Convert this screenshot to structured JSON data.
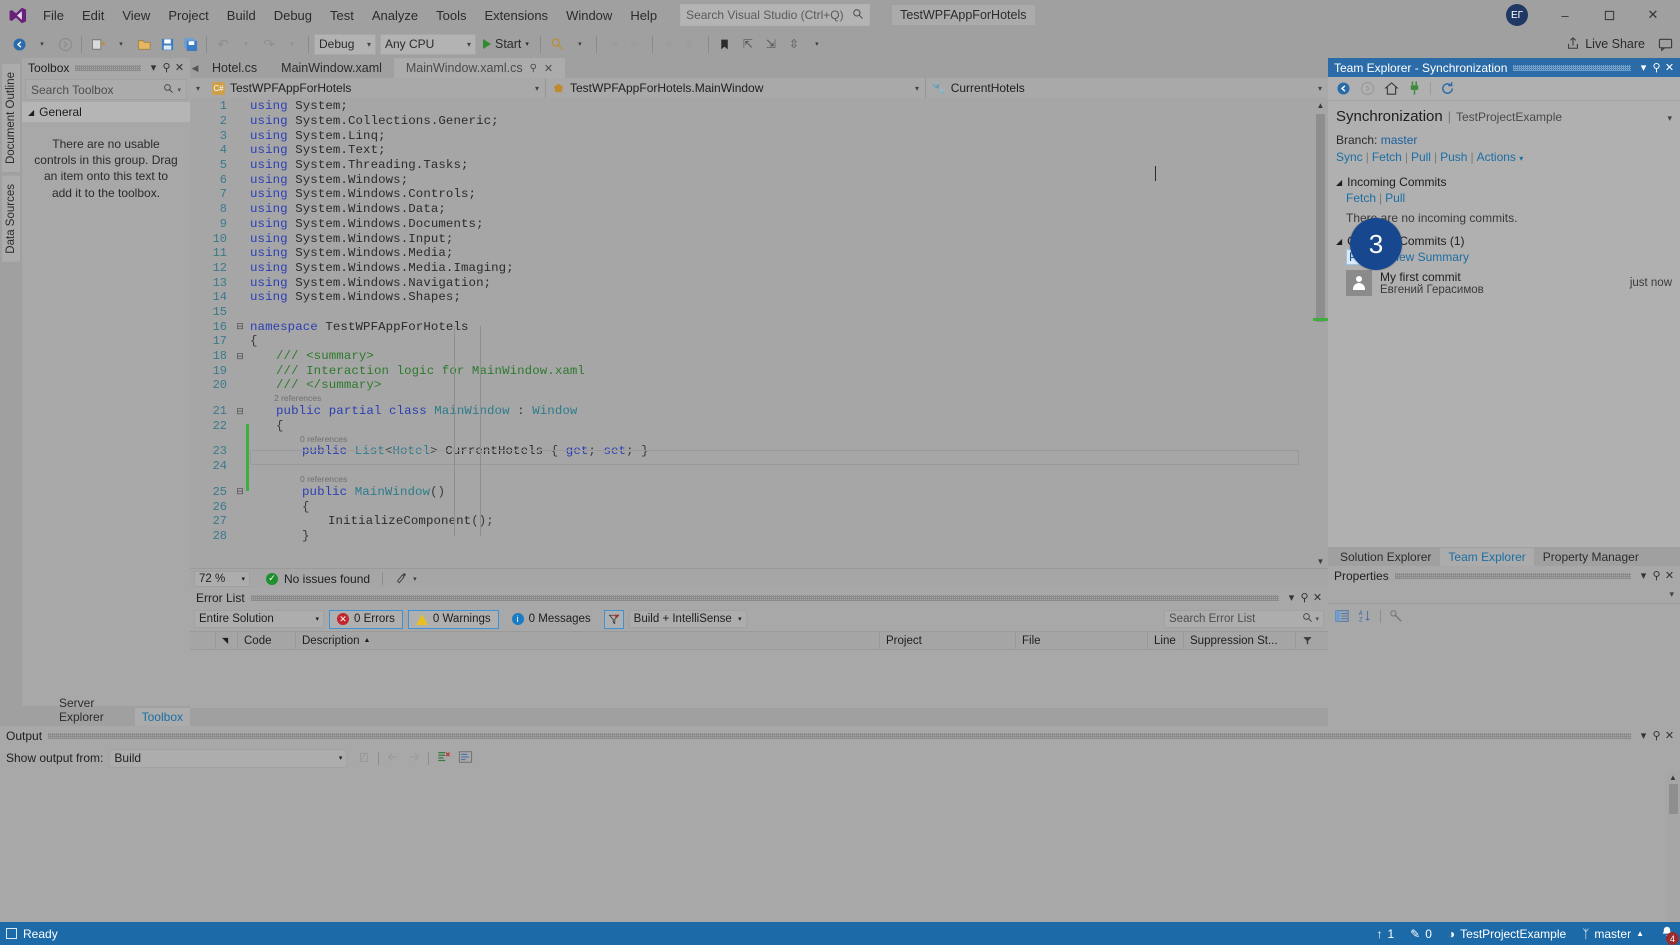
{
  "titlebar": {
    "logo_icon": "visual-studio-logo",
    "menus": [
      "File",
      "Edit",
      "View",
      "Project",
      "Build",
      "Debug",
      "Test",
      "Analyze",
      "Tools",
      "Extensions",
      "Window",
      "Help"
    ],
    "search_placeholder": "Search Visual Studio (Ctrl+Q)",
    "search_icon": "search-icon",
    "solution_name": "TestWPFAppForHotels",
    "account_initials": "ЕГ",
    "minimize": "–",
    "maximize": "☐",
    "close": "✕"
  },
  "toolbar": {
    "nav_back": "⮜",
    "nav_fwd": "⮞",
    "new_project": "New Project",
    "open": "Open",
    "save": "Save",
    "save_all": "Save All",
    "undo": "↶",
    "redo": "↷",
    "config": "Debug",
    "platform": "Any CPU",
    "start_label": "Start",
    "live_share": "Live Share",
    "share_icon": "share-icon",
    "feedback_icon": "feedback-icon"
  },
  "vertical_tabs": [
    "Document Outline",
    "Data Sources"
  ],
  "toolbox": {
    "title": "Toolbox",
    "search_placeholder": "Search Toolbox",
    "group": "General",
    "empty_message": "There are no usable controls in this group. Drag an item onto this text to add it to the toolbox.",
    "dropdown_icon": "chevron-down-icon",
    "pin_icon": "pin-icon",
    "close_icon": "close-icon"
  },
  "left_dock_tabs": [
    {
      "label": "Server Explorer",
      "active": false
    },
    {
      "label": "Toolbox",
      "active": true
    }
  ],
  "editor": {
    "tabs": [
      {
        "label": "Hotel.cs",
        "active": false
      },
      {
        "label": "MainWindow.xaml",
        "active": false
      },
      {
        "label": "MainWindow.xaml.cs",
        "active": true
      }
    ],
    "navbar": {
      "project": "TestWPFAppForHotels",
      "type": "TestWPFAppForHotels.MainWindow",
      "member": "CurrentHotels"
    },
    "zoom_level": "72 %",
    "issues_status": "No issues found",
    "lines": [
      {
        "n": "1",
        "indent": 0,
        "tokens": [
          {
            "t": "using ",
            "c": "kw"
          },
          {
            "t": "System;",
            "c": "nm"
          }
        ],
        "glyph": "",
        "refs": ""
      },
      {
        "n": "2",
        "indent": 0,
        "tokens": [
          {
            "t": "using ",
            "c": "kw"
          },
          {
            "t": "System.Collections.Generic;",
            "c": "nm"
          }
        ],
        "glyph": "",
        "refs": ""
      },
      {
        "n": "3",
        "indent": 0,
        "tokens": [
          {
            "t": "using ",
            "c": "kw"
          },
          {
            "t": "System.Linq;",
            "c": "nm"
          }
        ],
        "glyph": "",
        "refs": ""
      },
      {
        "n": "4",
        "indent": 0,
        "tokens": [
          {
            "t": "using ",
            "c": "kw"
          },
          {
            "t": "System.Text;",
            "c": "nm"
          }
        ],
        "glyph": "",
        "refs": ""
      },
      {
        "n": "5",
        "indent": 0,
        "tokens": [
          {
            "t": "using ",
            "c": "kw"
          },
          {
            "t": "System.Threading.Tasks;",
            "c": "nm"
          }
        ],
        "glyph": "",
        "refs": ""
      },
      {
        "n": "6",
        "indent": 0,
        "tokens": [
          {
            "t": "using ",
            "c": "kw"
          },
          {
            "t": "System.Windows;",
            "c": "nm"
          }
        ],
        "glyph": "",
        "refs": ""
      },
      {
        "n": "7",
        "indent": 0,
        "tokens": [
          {
            "t": "using ",
            "c": "kw"
          },
          {
            "t": "System.Windows.Controls;",
            "c": "nm"
          }
        ],
        "glyph": "",
        "refs": ""
      },
      {
        "n": "8",
        "indent": 0,
        "tokens": [
          {
            "t": "using ",
            "c": "kw"
          },
          {
            "t": "System.Windows.Data;",
            "c": "nm"
          }
        ],
        "glyph": "",
        "refs": ""
      },
      {
        "n": "9",
        "indent": 0,
        "tokens": [
          {
            "t": "using ",
            "c": "kw"
          },
          {
            "t": "System.Windows.Documents;",
            "c": "nm"
          }
        ],
        "glyph": "",
        "refs": ""
      },
      {
        "n": "10",
        "indent": 0,
        "tokens": [
          {
            "t": "using ",
            "c": "kw"
          },
          {
            "t": "System.Windows.Input;",
            "c": "nm"
          }
        ],
        "glyph": "",
        "refs": ""
      },
      {
        "n": "11",
        "indent": 0,
        "tokens": [
          {
            "t": "using ",
            "c": "kw"
          },
          {
            "t": "System.Windows.Media;",
            "c": "nm"
          }
        ],
        "glyph": "",
        "refs": ""
      },
      {
        "n": "12",
        "indent": 0,
        "tokens": [
          {
            "t": "using ",
            "c": "kw"
          },
          {
            "t": "System.Windows.Media.Imaging;",
            "c": "nm"
          }
        ],
        "glyph": "",
        "refs": ""
      },
      {
        "n": "13",
        "indent": 0,
        "tokens": [
          {
            "t": "using ",
            "c": "kw"
          },
          {
            "t": "System.Windows.Navigation;",
            "c": "nm"
          }
        ],
        "glyph": "",
        "refs": ""
      },
      {
        "n": "14",
        "indent": 0,
        "tokens": [
          {
            "t": "using ",
            "c": "kw"
          },
          {
            "t": "System.Windows.Shapes;",
            "c": "nm"
          }
        ],
        "glyph": "",
        "refs": ""
      },
      {
        "n": "15",
        "indent": 0,
        "tokens": [],
        "glyph": "",
        "refs": ""
      },
      {
        "n": "16",
        "indent": 0,
        "tokens": [
          {
            "t": "namespace ",
            "c": "kw"
          },
          {
            "t": "TestWPFAppForHotels",
            "c": "nm"
          }
        ],
        "glyph": "⊟",
        "refs": ""
      },
      {
        "n": "17",
        "indent": 0,
        "tokens": [
          {
            "t": "{",
            "c": "op"
          }
        ],
        "glyph": "",
        "refs": ""
      },
      {
        "n": "18",
        "indent": 1,
        "tokens": [
          {
            "t": "/// <summary>",
            "c": "cm"
          }
        ],
        "glyph": "⊟",
        "refs": ""
      },
      {
        "n": "19",
        "indent": 1,
        "tokens": [
          {
            "t": "/// Interaction logic for MainWindow.xaml",
            "c": "cm"
          }
        ],
        "glyph": "",
        "refs": ""
      },
      {
        "n": "20",
        "indent": 1,
        "tokens": [
          {
            "t": "/// </summary>",
            "c": "cm"
          }
        ],
        "glyph": "",
        "refs": ""
      },
      {
        "n": "21",
        "indent": 1,
        "tokens": [
          {
            "t": "public ",
            "c": "kw"
          },
          {
            "t": "partial ",
            "c": "kw"
          },
          {
            "t": "class ",
            "c": "kw"
          },
          {
            "t": "MainWindow",
            "c": "ty"
          },
          {
            "t": " : ",
            "c": "op"
          },
          {
            "t": "Window",
            "c": "ty"
          }
        ],
        "glyph": "⊟",
        "refs": "2 references"
      },
      {
        "n": "22",
        "indent": 1,
        "tokens": [
          {
            "t": "{",
            "c": "op"
          }
        ],
        "glyph": "",
        "refs": ""
      },
      {
        "n": "23",
        "indent": 2,
        "tokens": [
          {
            "t": "public ",
            "c": "kw"
          },
          {
            "t": "List",
            "c": "ty"
          },
          {
            "t": "<",
            "c": "op"
          },
          {
            "t": "Hotel",
            "c": "ty"
          },
          {
            "t": "> ",
            "c": "op"
          },
          {
            "t": "CurrentHotels",
            "c": "nm"
          },
          {
            "t": " { ",
            "c": "op"
          },
          {
            "t": "get",
            "c": "kw"
          },
          {
            "t": "; ",
            "c": "op"
          },
          {
            "t": "set",
            "c": "kw"
          },
          {
            "t": "; }",
            "c": "op"
          }
        ],
        "glyph": "",
        "refs": "0 references"
      },
      {
        "n": "24",
        "indent": 2,
        "tokens": [],
        "glyph": "",
        "refs": ""
      },
      {
        "n": "25",
        "indent": 2,
        "tokens": [
          {
            "t": "public ",
            "c": "kw"
          },
          {
            "t": "MainWindow",
            "c": "ty"
          },
          {
            "t": "()",
            "c": "op"
          }
        ],
        "glyph": "⊟",
        "refs": "0 references"
      },
      {
        "n": "26",
        "indent": 2,
        "tokens": [
          {
            "t": "{",
            "c": "op"
          }
        ],
        "glyph": "",
        "refs": ""
      },
      {
        "n": "27",
        "indent": 3,
        "tokens": [
          {
            "t": "InitializeComponent",
            "c": "nm"
          },
          {
            "t": "();",
            "c": "op"
          }
        ],
        "glyph": "",
        "refs": ""
      },
      {
        "n": "28",
        "indent": 2,
        "tokens": [
          {
            "t": "}",
            "c": "op"
          }
        ],
        "glyph": "",
        "refs": ""
      }
    ]
  },
  "error_list": {
    "title": "Error List",
    "scope": "Entire Solution",
    "errors_label": "0 Errors",
    "warnings_label": "0 Warnings",
    "messages_label": "0 Messages",
    "build_filter": "Build + IntelliSense",
    "search_placeholder": "Search Error List",
    "columns": [
      "",
      "",
      "Code",
      "Description",
      "Project",
      "File",
      "Line",
      "Suppression St..."
    ],
    "sort_indicator": "▲",
    "rows": []
  },
  "output": {
    "title": "Output",
    "show_output_from_label": "Show output from:",
    "source": "Build",
    "icons": [
      "clear-output-icon",
      "go-to-previous-icon",
      "go-to-next-icon",
      "clear-all-icon",
      "toggle-wordwrap-icon"
    ],
    "content": ""
  },
  "team_explorer": {
    "title": "Team Explorer - Synchronization",
    "nav_icons": [
      "back-icon",
      "forward-icon",
      "home-icon",
      "connect-icon",
      "refresh-icon"
    ],
    "page_title": "Synchronization",
    "page_separator": "|",
    "repo_name": "TestProjectExample",
    "branch_label": "Branch:",
    "branch_name": "master",
    "action_links": [
      "Sync",
      "Fetch",
      "Pull",
      "Push",
      "Actions"
    ],
    "incoming": {
      "header": "Incoming Commits",
      "links": [
        "Fetch",
        "Pull"
      ],
      "empty_message": "There are no incoming commits."
    },
    "outgoing": {
      "header": "Outgoing Commits (1)",
      "links": [
        "Push",
        "View Summary"
      ],
      "commit_message": "My first commit",
      "commit_author": "Евгений Герасимов",
      "commit_time": "just now"
    },
    "dock_tabs": [
      {
        "label": "Solution Explorer",
        "active": false
      },
      {
        "label": "Team Explorer",
        "active": true
      },
      {
        "label": "Property Manager",
        "active": false
      }
    ]
  },
  "properties": {
    "title": "Properties",
    "toolbar_icons": [
      "categorized-icon",
      "alphabetical-icon",
      "properties-icon"
    ]
  },
  "statusbar": {
    "ready": "Ready",
    "up_count": "1",
    "pencil_count": "0",
    "repo": "TestProjectExample",
    "branch": "master",
    "notification_count": "4"
  },
  "callout": {
    "number": "3",
    "accent_color": "#16478f"
  }
}
